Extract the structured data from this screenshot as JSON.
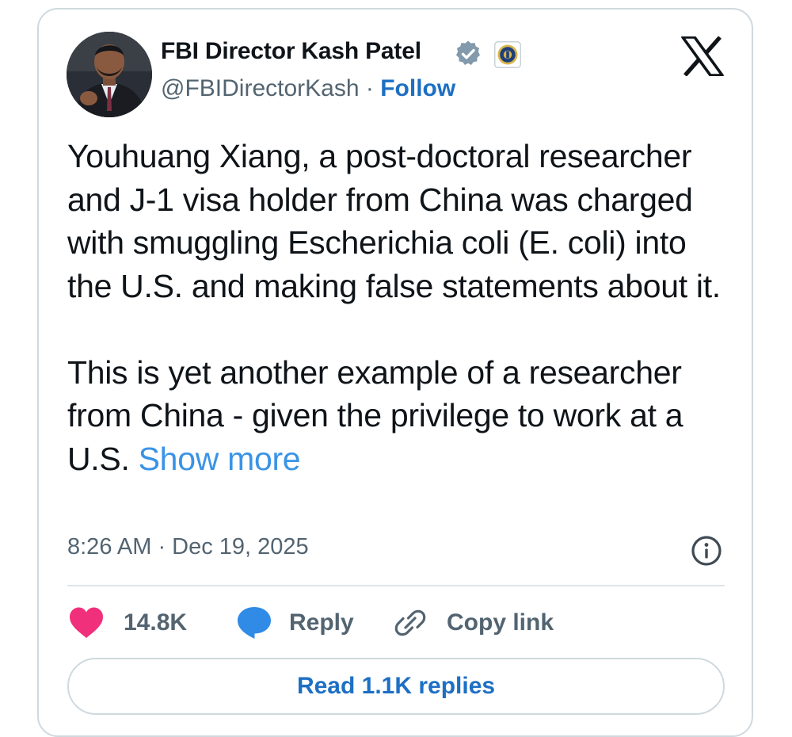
{
  "author": {
    "display_name": "FBI Director Kash Patel",
    "handle": "@FBIDirectorKash",
    "separator": "·",
    "follow_label": "Follow",
    "verified_badge_icon": "verified-badge-icon",
    "affiliate_badge_icon": "fbi-seal-icon",
    "avatar": "profile-photo"
  },
  "platform_logo": "x-logo-icon",
  "tweet": {
    "paragraph_1": "Youhuang Xiang, a post-doctoral researcher and J-1 visa holder from China was charged with smuggling Escherichia coli (E. coli) into the U.S. and making false statements about it.",
    "paragraph_2": "This is yet another example of a researcher from China - given the privilege to work at a U.S.",
    "show_more_label": "Show more"
  },
  "timestamp": "8:26 AM · Dec 19, 2025",
  "actions": {
    "like_count": "14.8K",
    "reply_label": "Reply",
    "copy_link_label": "Copy link"
  },
  "read_replies_label": "Read 1.1K replies",
  "colors": {
    "text": "#0f1419",
    "secondary": "#536471",
    "link": "#1d6fc4",
    "show_more": "#3a93e6",
    "like": "#f0307a",
    "reply": "#2f8be6",
    "border": "#cfd9de"
  }
}
